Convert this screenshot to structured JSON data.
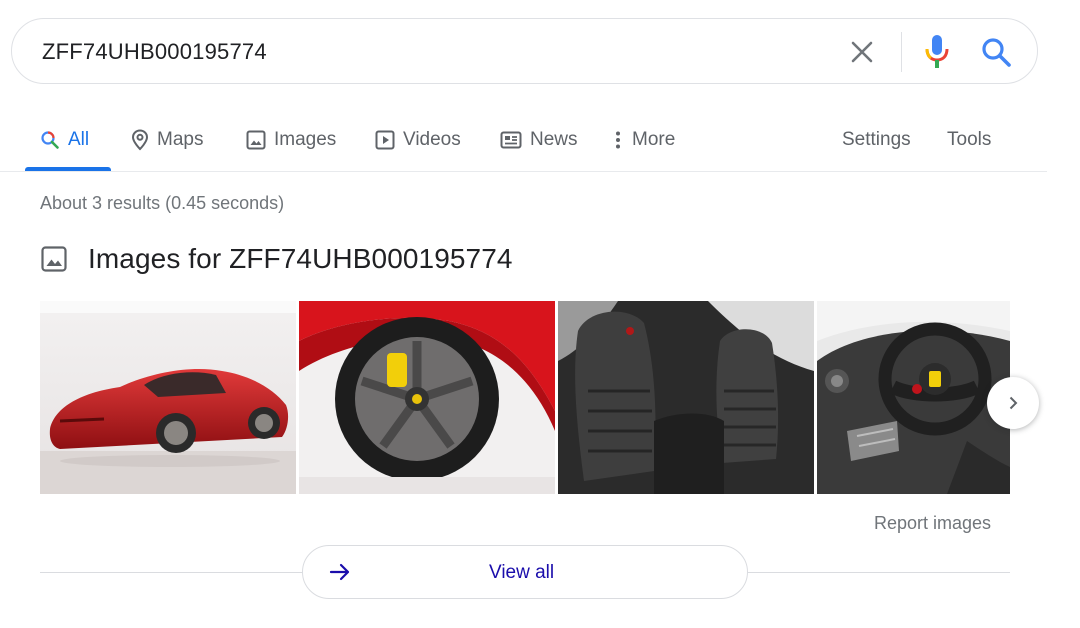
{
  "search": {
    "query": "ZFF74UHB000195774"
  },
  "tabs": [
    {
      "label": "All",
      "icon": "search-icon"
    },
    {
      "label": "Maps",
      "icon": "map-pin-icon"
    },
    {
      "label": "Images",
      "icon": "image-icon"
    },
    {
      "label": "Videos",
      "icon": "play-icon"
    },
    {
      "label": "News",
      "icon": "news-icon"
    },
    {
      "label": "More",
      "icon": "more-vert-icon"
    },
    {
      "label": "Settings"
    },
    {
      "label": "Tools"
    }
  ],
  "results": {
    "stats": "About 3 results (0.45 seconds)"
  },
  "images_section": {
    "title": "Images for ZFF74UHB000195774",
    "thumbnails": [
      {
        "subject": "red Ferrari F12 exterior side view"
      },
      {
        "subject": "Ferrari wheel with yellow brake caliper"
      },
      {
        "subject": "black leather seats interior"
      },
      {
        "subject": "steering wheel and dashboard"
      }
    ],
    "report_label": "Report images",
    "view_all_label": "View all"
  },
  "colors": {
    "accent": "#1a73e8",
    "link": "#1a0dab",
    "muted": "#70757a",
    "car_red": "#c8102e"
  }
}
